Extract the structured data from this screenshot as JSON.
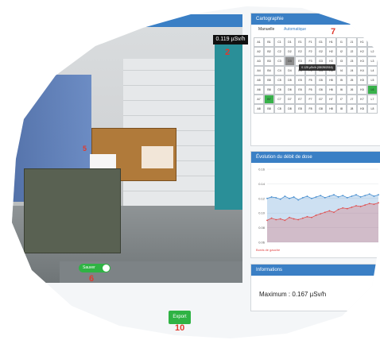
{
  "camera": {
    "dose_rate": "0.119 µSv/h",
    "annotation_2": "2",
    "annotation_5": "5",
    "annotation_6": "6",
    "save_toggle_label": "Sauver"
  },
  "export": {
    "button_label": "Export",
    "annotation_10": "10"
  },
  "cartography": {
    "title": "Cartographie",
    "tab_manual": "Manuelle",
    "tab_auto": "Automatique",
    "annotation_7": "7",
    "rows": [
      "1",
      "2",
      "3",
      "4",
      "5",
      "6",
      "7",
      "8"
    ],
    "cols": [
      "A",
      "B",
      "C",
      "D",
      "E",
      "F",
      "G",
      "H",
      "I",
      "J",
      "K",
      "L"
    ],
    "green_cells": [
      "L6",
      "B7"
    ],
    "grey_cells": [
      "D3"
    ],
    "tooltip": "0.125 µSv/h (08/28/2016)",
    "tooltip_anchor": "D3"
  },
  "dose_chart": {
    "title": "Évolution du débit de dose",
    "legend_left": "Bords de gauche",
    "colors": {
      "series_a": "#e05050",
      "series_b": "#4a90d0",
      "grid": "#e2e5e8"
    }
  },
  "chart_data": {
    "type": "area",
    "title": "Évolution du débit de dose",
    "xlabel": "",
    "ylabel": "",
    "yticks": [
      "0.16",
      "0.14",
      "0.12",
      "0.10",
      "0.08",
      "0.06"
    ],
    "ylim": [
      0.06,
      0.16
    ],
    "series": [
      {
        "name": "Bords de gauche",
        "values": [
          0.09,
          0.093,
          0.091,
          0.092,
          0.09,
          0.094,
          0.092,
          0.091,
          0.093,
          0.095,
          0.094,
          0.097,
          0.099,
          0.101,
          0.103,
          0.101,
          0.105,
          0.107,
          0.106,
          0.108,
          0.11,
          0.109,
          0.111,
          0.113,
          0.112,
          0.114
        ]
      },
      {
        "values": [
          0.12,
          0.122,
          0.121,
          0.119,
          0.123,
          0.12,
          0.122,
          0.118,
          0.121,
          0.123,
          0.12,
          0.122,
          0.124,
          0.121,
          0.123,
          0.125,
          0.122,
          0.124,
          0.121,
          0.123,
          0.125,
          0.122,
          0.124,
          0.126,
          0.123,
          0.125
        ]
      }
    ]
  },
  "info": {
    "title": "Informations",
    "maximum": "Maximum : 0.167 µSv/h"
  }
}
